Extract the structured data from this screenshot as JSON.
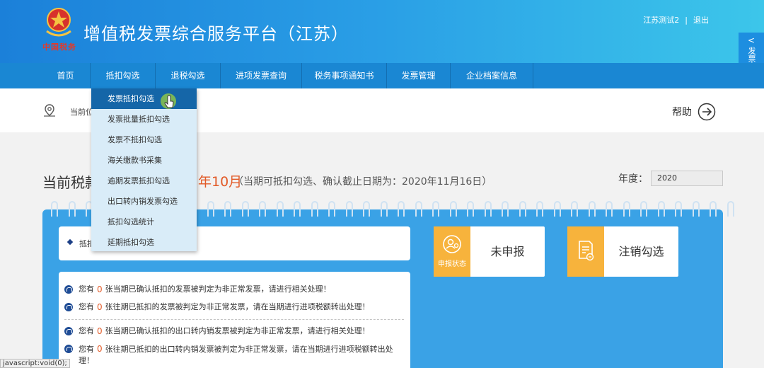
{
  "header": {
    "app_title": "增值税发票综合服务平台（江苏）",
    "brand_subtitle": "中国税务",
    "user_name": "江苏测试2",
    "separator": "|",
    "logout": "退出",
    "side_tab_chevron": "<",
    "side_tab_label": "发票查验平台"
  },
  "nav": [
    {
      "label": "首页"
    },
    {
      "label": "抵扣勾选"
    },
    {
      "label": "退税勾选"
    },
    {
      "label": "进项发票查询"
    },
    {
      "label": "税务事项通知书"
    },
    {
      "label": "发票管理"
    },
    {
      "label": "企业档案信息"
    }
  ],
  "dropdown": [
    {
      "label": "发票抵扣勾选",
      "active": true
    },
    {
      "label": "发票批量抵扣勾选"
    },
    {
      "label": "发票不抵扣勾选"
    },
    {
      "label": "海关缴款书采集"
    },
    {
      "label": "逾期发票抵扣勾选"
    },
    {
      "label": "出口转内销发票勾选"
    },
    {
      "label": "抵扣勾选统计"
    },
    {
      "label": "延期抵扣勾选"
    }
  ],
  "breadcrumb": {
    "text": "当前位"
  },
  "help": {
    "label": "帮助",
    "icon": "arrow-right-circle-icon"
  },
  "period": {
    "label": "当前税款",
    "month": "年10月",
    "note": "（当期可抵扣勾选、确认截止日期为：2020年11月16日）"
  },
  "year": {
    "label": "年度：",
    "value": "2020"
  },
  "notice": {
    "text": "抵扣"
  },
  "messages": [
    {
      "prefix": "您有",
      "count": "0",
      "text": "张当期已确认抵扣的发票被判定为非正常发票，请进行相关处理！"
    },
    {
      "prefix": "您有",
      "count": "0",
      "text": "张往期已抵扣的发票被判定为非正常发票，请在当期进行进项税额转出处理！"
    },
    {
      "prefix": "您有",
      "count": "0",
      "text": "张当期已确认抵扣的出口转内销发票被判定为非正常发票，请进行相关处理！"
    },
    {
      "prefix": "您有",
      "count": "0",
      "text": "张往期已抵扣的出口转内销发票被判定为非正常发票，请在当期进行进项税额转出处理！"
    }
  ],
  "status_card": {
    "icon_label": "申报状态",
    "value": "未申报",
    "icon": "user-status-icon"
  },
  "cancel_card": {
    "label": "注销勾选",
    "icon": "document-cancel-icon"
  },
  "statusbar": {
    "text": "javascript:void(0);"
  },
  "colors": {
    "header_blue": "#1b80d9",
    "nav_blue": "#1a87d3",
    "accent_orange": "#f7b33c",
    "highlight_red": "#e25b28"
  }
}
